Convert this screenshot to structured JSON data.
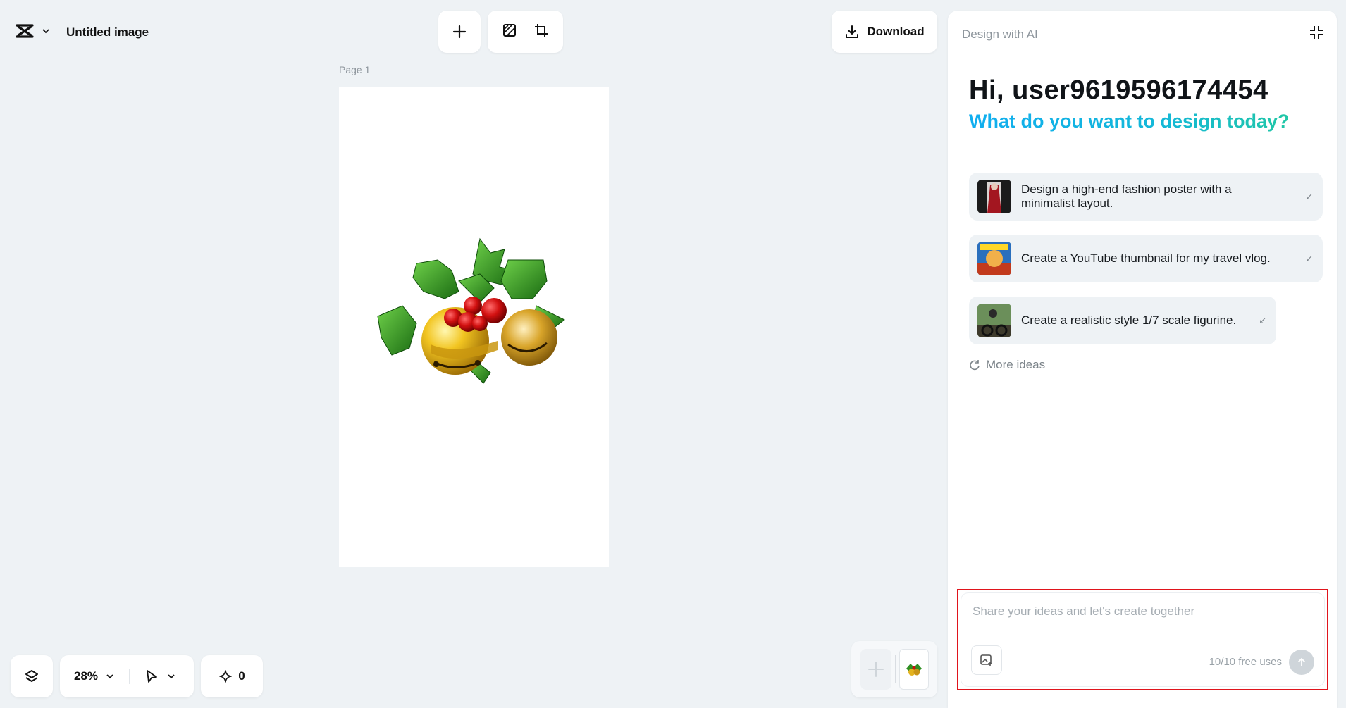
{
  "header": {
    "doc_title": "Untitled image"
  },
  "toolbar": {
    "download_label": "Download"
  },
  "canvas": {
    "page_label": "Page 1"
  },
  "bottom_controls": {
    "zoom_level": "28%",
    "ai_count": "0"
  },
  "panel": {
    "title": "Design with AI",
    "greeting": "Hi, user9619596174454",
    "subheading": "What do you want to design today?",
    "ideas": [
      {
        "text": "Design a high-end fashion poster with a minimalist layout."
      },
      {
        "text": "Create a YouTube thumbnail for my travel vlog."
      },
      {
        "text": "Create a realistic style 1/7 scale figurine."
      }
    ],
    "more_ideas_label": "More ideas",
    "input": {
      "placeholder": "Share your ideas and let's create together",
      "value": "",
      "free_uses": "10/10 free uses"
    }
  },
  "colors": {
    "background": "#eef2f5",
    "accent_gradient_start": "#11aef0",
    "accent_gradient_end": "#21c7a6",
    "highlight_border": "#e0141c"
  }
}
